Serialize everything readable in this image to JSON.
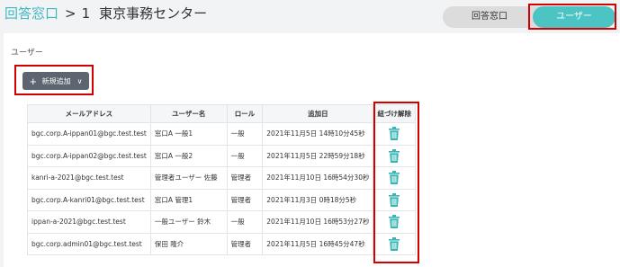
{
  "breadcrumb": {
    "link": "回答窓口",
    "separator": ">",
    "number": "1",
    "current": "東京事務センター"
  },
  "toggle": {
    "window_label": "回答窓口",
    "user_label": "ユーザー"
  },
  "section": {
    "title": "ユーザー"
  },
  "add_button": {
    "label": "新規追加",
    "plus": "+",
    "chevron": "∨"
  },
  "table": {
    "headers": [
      "メールアドレス",
      "ユーザー名",
      "ロール",
      "追加日",
      "紐づけ解除"
    ],
    "rows": [
      [
        "bgc.corp.A-ippan01@bgc.test.test",
        "窓口A 一般1",
        "一般",
        "2021年11月5日 14時10分45秒"
      ],
      [
        "bgc.corp.A-ippan02@bgc.test.test",
        "窓口A 一般2",
        "一般",
        "2021年11月5日 22時59分18秒"
      ],
      [
        "kanri-a-2021@bgc.test.test",
        "管理者ユーザー 佐藤",
        "管理者",
        "2021年11月10日 16時54分30秒"
      ],
      [
        "bgc.corp.A-kanri01@bgc.test.test",
        "窓口A 管理1",
        "管理者",
        "2021年11月3日 0時18分5秒"
      ],
      [
        "ippan-a-2021@bgc.test.test",
        "一般ユーザー 鈴木",
        "一般",
        "2021年11月10日 16時53分27秒"
      ],
      [
        "bgc.corp.admin01@bgc.test.test",
        "保田 隆介",
        "管理者",
        "2021年11月5日 16時45分47秒"
      ]
    ]
  },
  "colors": {
    "accent": "#4cc4c4",
    "highlight": "#d40000",
    "trash": "#3ab5b5"
  }
}
